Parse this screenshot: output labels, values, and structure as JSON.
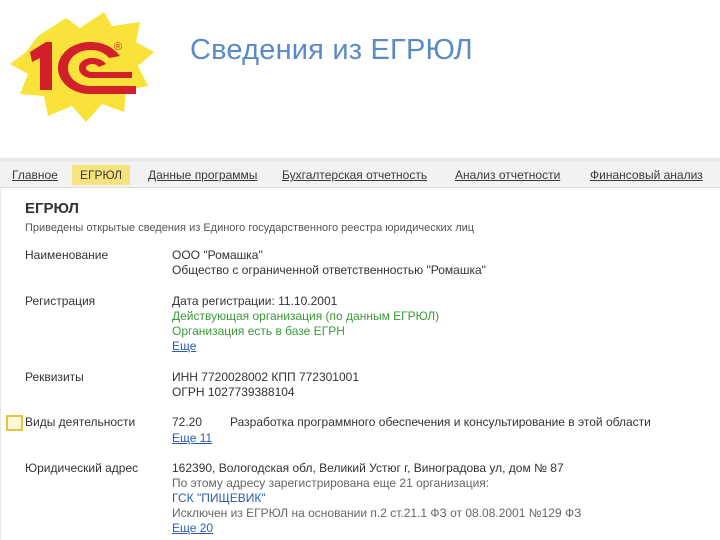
{
  "slide": {
    "title": "Сведения из ЕГРЮЛ"
  },
  "logo": {
    "text": "1С",
    "registered": "®",
    "colors": {
      "yellow": "#f9e23a",
      "red": "#d31f2a"
    }
  },
  "tabs": [
    {
      "label": "Главное",
      "active": false
    },
    {
      "label": "ЕГРЮЛ",
      "active": true
    },
    {
      "label": "Данные программы",
      "active": false
    },
    {
      "label": "Бухгалтерская отчетность",
      "active": false
    },
    {
      "label": "Анализ отчетности",
      "active": false
    },
    {
      "label": "Финансовый анализ",
      "active": false
    }
  ],
  "form": {
    "title": "ЕГРЮЛ",
    "subtitle": "Приведены открытые сведения из Единого государственного реестра юридических лиц"
  },
  "sections": {
    "name": {
      "label": "Наименование",
      "short": "ООО \"Ромашка\"",
      "full": "Общество с ограниченной ответственностью \"Ромашка\""
    },
    "registration": {
      "label": "Регистрация",
      "date": "Дата регистрации: 11.10.2001",
      "status": "Действующая организация (по данным ЕГРЮЛ)",
      "egrn": "Организация есть в базе ЕГРН",
      "more": "Еще"
    },
    "requisites": {
      "label": "Реквизиты",
      "inn_kpp": "ИНН 7720028002 КПП 772301001",
      "ogrn": "ОГРН 1027739388104"
    },
    "activities": {
      "label": "Виды деятельности",
      "code": "72.20",
      "description": "Разработка программного обеспечения и консультирование в этой области",
      "more": "Еще 11"
    },
    "address": {
      "label": "Юридический адрес",
      "value": "162390, Вологодская обл, Великий Устюг г, Виноградова ул, дом № 87",
      "note": "По этому адресу зарегистрирована еще 21 организация:",
      "org": "ГСК \"ПИЩЕВИК\"",
      "excluded": "Исключен из ЕГРЮЛ на основании п.2 ст.21.1 ФЗ от 08.08.2001 №129 ФЗ",
      "more": "Еще 20"
    }
  }
}
